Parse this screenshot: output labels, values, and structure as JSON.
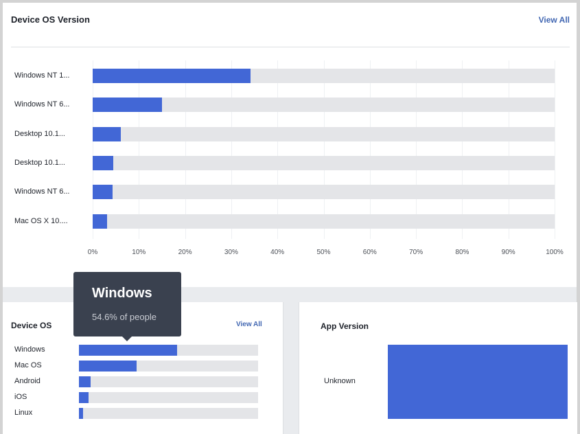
{
  "top_card": {
    "title": "Device OS Version",
    "view_all": "View All"
  },
  "os_card": {
    "title": "Device OS",
    "view_all": "View All"
  },
  "app_card": {
    "title": "App Version"
  },
  "tooltip": {
    "title": "Windows",
    "subtitle": "54.6% of people"
  },
  "colors": {
    "bar": "#4267d6",
    "track": "#e4e5e8",
    "link": "#4267b2",
    "tooltip_bg": "#3a414f"
  },
  "chart_data": [
    {
      "type": "bar",
      "orientation": "horizontal",
      "title": "Device OS Version",
      "categories": [
        "Windows NT 1...",
        "Windows NT 6...",
        "Desktop 10.1...",
        "Desktop 10.1...",
        "Windows NT 6...",
        "Mac OS X 10...."
      ],
      "values": [
        34.2,
        15.0,
        6.1,
        4.5,
        4.3,
        3.1
      ],
      "xlim": [
        0,
        100
      ],
      "x_ticks": [
        "0%",
        "10%",
        "20%",
        "30%",
        "40%",
        "50%",
        "60%",
        "70%",
        "80%",
        "90%",
        "100%"
      ],
      "grid": true,
      "unit": "%"
    },
    {
      "type": "bar",
      "orientation": "horizontal",
      "title": "Device OS",
      "categories": [
        "Windows",
        "Mac OS",
        "Android",
        "iOS",
        "Linux"
      ],
      "values": [
        54.6,
        32.2,
        6.5,
        5.4,
        2.3
      ],
      "xlim": [
        0,
        100
      ],
      "unit": "%"
    },
    {
      "type": "bar",
      "orientation": "horizontal",
      "title": "App Version",
      "categories": [
        "Unknown"
      ],
      "values": [
        100
      ],
      "xlim": [
        0,
        100
      ],
      "unit": "%"
    }
  ]
}
